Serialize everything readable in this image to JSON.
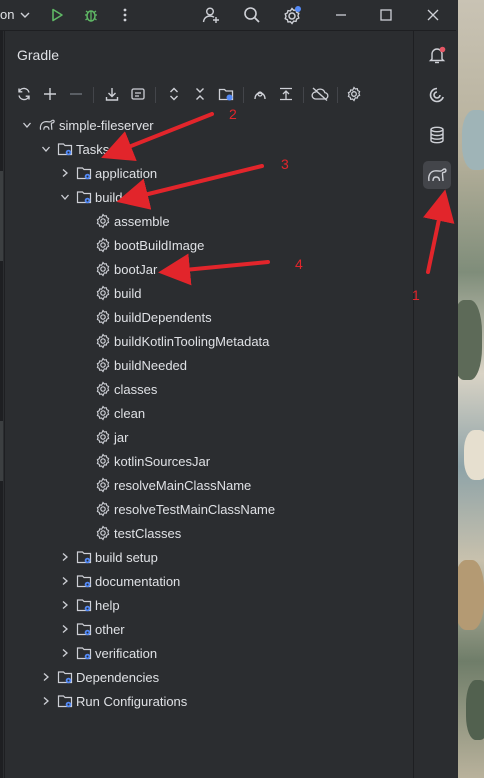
{
  "toolbar": {
    "run_config_label": "on",
    "icons": [
      "chevron-down-icon",
      "run-icon",
      "debug-icon",
      "more-vertical-icon",
      "add-user-icon",
      "search-icon",
      "settings-icon",
      "minimize-icon",
      "maximize-icon",
      "close-icon"
    ]
  },
  "gradle": {
    "title": "Gradle",
    "toolbar_icons": [
      "reload-icon",
      "add-icon",
      "remove-icon",
      "download-sources-icon",
      "run-task-icon",
      "expand-all-icon",
      "collapse-all-icon",
      "link-project-icon",
      "dependency-analyzer-icon",
      "show-tasks-icon",
      "offline-mode-icon",
      "gradle-settings-icon"
    ]
  },
  "tree": {
    "project": "simple-fileserver",
    "tasks": "Tasks",
    "groups": {
      "application": "application",
      "build": "build",
      "build_setup": "build setup",
      "documentation": "documentation",
      "help": "help",
      "other": "other",
      "verification": "verification"
    },
    "build_tasks": [
      "assemble",
      "bootBuildImage",
      "bootJar",
      "build",
      "buildDependents",
      "buildKotlinToolingMetadata",
      "buildNeeded",
      "classes",
      "clean",
      "jar",
      "kotlinSourcesJar",
      "resolveMainClassName",
      "resolveTestMainClassName",
      "testClasses"
    ],
    "dependencies": "Dependencies",
    "run_configurations": "Run Configurations"
  },
  "right_strip": {
    "icons": [
      "notifications-icon",
      "ai-assistant-icon",
      "database-icon",
      "gradle-icon"
    ],
    "active": "gradle-icon"
  },
  "annotations": {
    "color": "#e2252b",
    "labels": [
      "1",
      "2",
      "3",
      "4"
    ]
  },
  "colors": {
    "background": "#2b2d30",
    "text": "#dfe1e5",
    "icon": "#ced0d6",
    "run_green": "#5fb865",
    "badge_blue": "#548af7",
    "notification_red": "#e55765"
  }
}
